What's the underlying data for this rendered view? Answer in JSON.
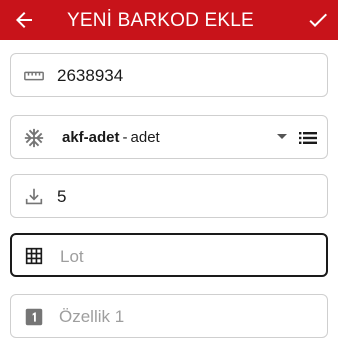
{
  "appbar": {
    "title": "YENİ BARKOD EKLE",
    "back_icon": "arrow-left-icon",
    "confirm_icon": "check-icon",
    "background": "#c8131a"
  },
  "fields": {
    "barcode": {
      "icon": "ruler-icon",
      "value": "2638934"
    },
    "unit": {
      "icon": "snowflake-icon",
      "code": "akf-adet",
      "separator": "-",
      "name": "adet",
      "dropdown_icon": "caret-down-icon",
      "list_icon": "list-icon"
    },
    "quantity": {
      "icon": "download-tray-icon",
      "value": "5"
    },
    "lot": {
      "icon": "grid-icon",
      "value": "",
      "placeholder": "Lot"
    },
    "feature1": {
      "icon": "number-one-icon",
      "value": "",
      "placeholder": "Özellik 1"
    }
  }
}
